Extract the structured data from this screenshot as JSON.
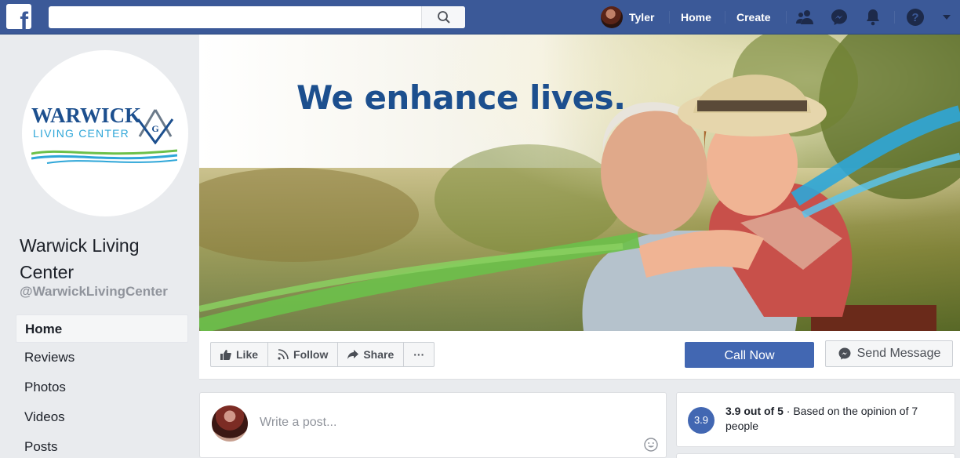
{
  "topbar": {
    "logo_letter": "f",
    "search": {
      "value": "",
      "placeholder": ""
    },
    "user_name": "Tyler",
    "home_label": "Home",
    "create_label": "Create",
    "icons": [
      "search-icon",
      "friends-icon",
      "messenger-icon",
      "notifications-icon",
      "help-icon",
      "dropdown-arrow-icon"
    ]
  },
  "profile": {
    "logo_name": "WARWICK",
    "logo_sub": "LIVING CENTER",
    "logo_emblem_letter": "G",
    "page_name": "Warwick Living Center",
    "handle": "@WarwickLivingCenter"
  },
  "sidebar": {
    "items": [
      {
        "label": "Home",
        "active": true
      },
      {
        "label": "Reviews",
        "active": false
      },
      {
        "label": "Photos",
        "active": false
      },
      {
        "label": "Videos",
        "active": false
      },
      {
        "label": "Posts",
        "active": false
      }
    ]
  },
  "cover": {
    "headline": "We enhance lives."
  },
  "actions": {
    "like": "Like",
    "follow": "Follow",
    "share": "Share",
    "more": "···",
    "call": "Call Now",
    "message": "Send Message"
  },
  "composer": {
    "placeholder": "Write a post..."
  },
  "rating": {
    "score": "3.9",
    "score_text": "3.9 out of 5",
    "detail": " · Based on the opinion of 7 people"
  },
  "colors": {
    "topbar": "#3b5998",
    "brand_blue": "#4267b2",
    "logo_navy": "#1c4f8e",
    "logo_cyan": "#2ea6d8",
    "swoosh_green": "#6cc04a"
  }
}
